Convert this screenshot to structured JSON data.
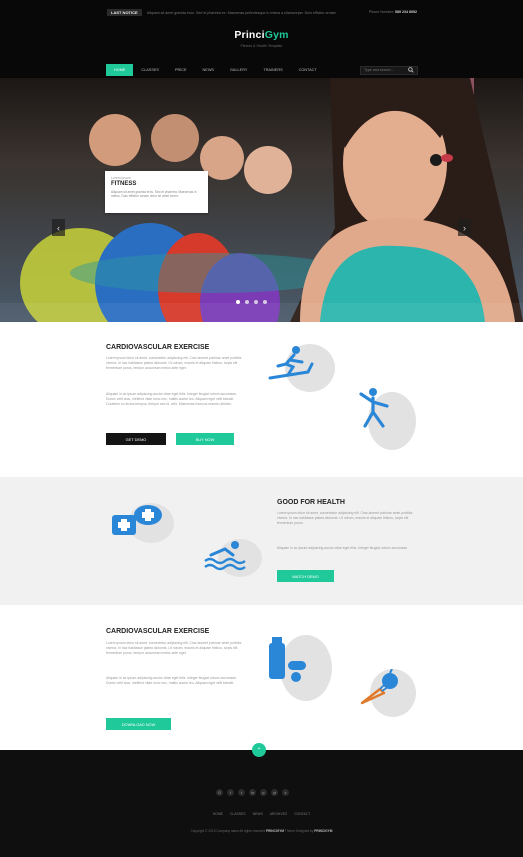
{
  "header": {
    "notice_label": "LAST NOTICE",
    "notice_text": "Aliquam sit amet gravida eros. Sed et pharetra ex. Maecenas pellentesque in metus a ullamcorper. Duis efficitur ornare",
    "phone_label": "Phone Number:",
    "phone_number": "589 234 8952",
    "logo_part1": "Princi",
    "logo_part2": "Gym",
    "tagline": "Fitness & Health Template"
  },
  "nav": {
    "items": [
      "HOME",
      "CLASSES",
      "PRICE",
      "NEWS",
      "GALLERY",
      "TRAINERS",
      "CONTACT"
    ],
    "active_index": 0,
    "search_placeholder": "Type and search..."
  },
  "hero": {
    "card_kicker": "Lorem ipsum",
    "card_title": "FITNESS",
    "card_text": "Aliquam sit amet gravida eros. Sed et pharetra. Maecenas in metus. Duis efficitur ornare dolor sit amet lorem.",
    "slides_total": 4,
    "slide_active": 1,
    "prev_glyph": "‹",
    "next_glyph": "›"
  },
  "section1": {
    "title": "CARDIOVASCULAR EXERCISE",
    "para1": "Lorem ipsum dolor sit amet, consectetur adipiscing elit. Cras laoreet pulvinar amet porttitor viverra. In hac habitasse platea dictumst. Ut rutrum, mauris et aliquam finibus, turpis elit fermentum purus, tempor accumsan metus ante eget.",
    "para2": "Aliquam in ac ipsum adipiscing auctor vitae eget felis. Integer feugiat rutrum accumsan. Donec velit arcu, eleifend vitae nunc nec, mattis auctor leo. Aliquam eget velit blandit. Curabitur eu lectus tempus, tempor sed id, velit. Maecenas rhoncus mauris ultricies.",
    "button1": "GET DEMO",
    "button2": "BUY NOW",
    "icons": [
      "treadmill-icon",
      "stretching-icon"
    ]
  },
  "section2": {
    "title": "GOOD FOR HEALTH",
    "para1": "Lorem ipsum dolor sit amet, consectetur adipiscing elit. Cras laoreet pulvinar amet porttitor viverra. In hac habitasse platea dictumst. Ut rutrum, mauris et aliquam finibus, turpis elit fermentum purus.",
    "para2": "Aliquam in ac ipsum adipiscing auctor vitae eget felis. Integer feugiat rutrum accumsan.",
    "button": "WATCH DEMO",
    "icons": [
      "first-aid-icon",
      "swimming-icon"
    ]
  },
  "section3": {
    "title": "CARDIOVASCULAR EXERCISE",
    "para1": "Lorem ipsum dolor sit amet, consectetur adipiscing elit. Cras laoreet pulvinar amet porttitor viverra. In hac habitasse platea dictumst. Ut rutrum, mauris et aliquam finibus, turpis elit fermentum purus, tempor accumsan metus ante eget.",
    "para2": "Aliquam in ac ipsum adipiscing auctor vitae eget felis. Integer feugiat rutrum accumsan. Donec velit arcu, eleifend vitae nunc nec, mattis auctor leo. Aliquam eget velit blandit.",
    "button": "DOWNLOAD NOW",
    "icons": [
      "supplements-icon",
      "fruit-icon"
    ]
  },
  "footer": {
    "to_top_glyph": "⌃",
    "socials": [
      "G",
      "f",
      "t",
      "in",
      "p",
      "yt",
      "v"
    ],
    "links": [
      "HOME",
      "CLASSES",
      "NEWS",
      "ARCHIVES",
      "CONTACT"
    ],
    "copyright_prefix": "Copyright © 2015 Company name All rights reserved",
    "copyright_brand": "PRINCIGYM",
    "copyright_mid": "Theme Designed by",
    "copyright_designer": "PRINCIGYM"
  },
  "colors": {
    "accent": "#1fc99a",
    "icon_blue": "#2a86d6",
    "dark": "#0f0f0f"
  }
}
